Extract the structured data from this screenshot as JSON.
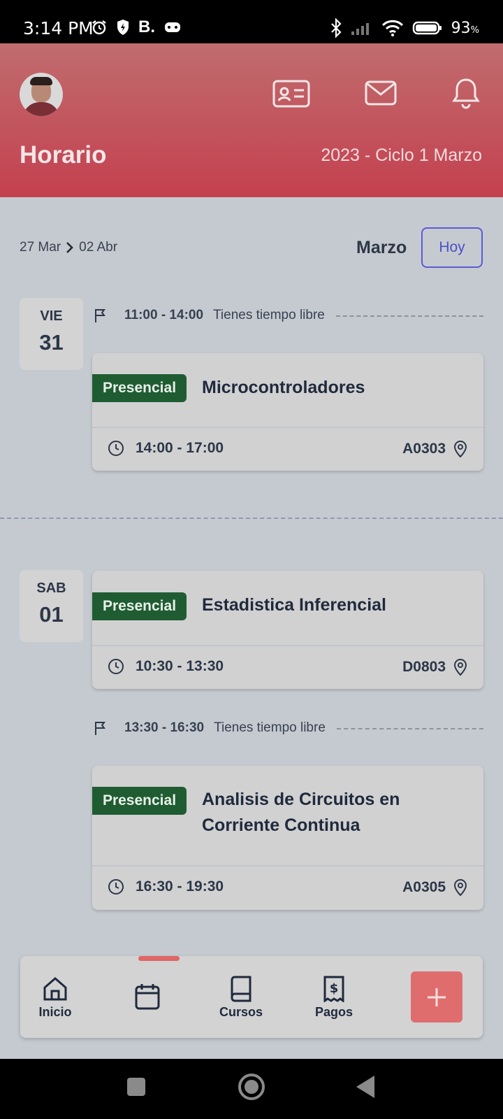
{
  "statusbar": {
    "time": "3:14 PM",
    "left_icons": [
      "alarm-icon",
      "shield-icon",
      "booking-icon",
      "game-icon"
    ],
    "b_label": "B.",
    "battery": "93",
    "battery_unit": "%"
  },
  "header": {
    "title": "Horario",
    "cycle": "2023 - Ciclo 1 Marzo",
    "icons": [
      "id-card-icon",
      "mail-icon",
      "bell-icon"
    ]
  },
  "dates": {
    "start": "27 Mar",
    "end": "02 Abr",
    "month": "Marzo",
    "today_button": "Hoy"
  },
  "days": [
    {
      "name": "VIE",
      "num": "31"
    },
    {
      "name": "SAB",
      "num": "01"
    }
  ],
  "free_slots": [
    {
      "time": "11:00 - 14:00",
      "text": "Tienes tiempo libre"
    },
    {
      "time": "13:30 - 16:30",
      "text": "Tienes tiempo libre"
    }
  ],
  "classes": [
    {
      "mode": "Presencial",
      "name": "Microcontroladores",
      "time": "14:00 - 17:00",
      "room": "A0303"
    },
    {
      "mode": "Presencial",
      "name": "Estadistica Inferencial",
      "time": "10:30 - 13:30",
      "room": "D0803"
    },
    {
      "mode": "Presencial",
      "name_line1": "Analisis de Circuitos en",
      "name_line2": "Corriente Continua",
      "time": "16:30 - 19:30",
      "room": "A0305"
    }
  ],
  "nav": {
    "inicio": "Inicio",
    "cursos": "Cursos",
    "pagos": "Pagos",
    "active": "calendar"
  },
  "colors": {
    "header_top": "#c06c6e",
    "header_bottom": "#c4404f",
    "badge": "#1f5c32",
    "accent_blue": "#5b5bd6",
    "fab": "#e06d6d"
  }
}
